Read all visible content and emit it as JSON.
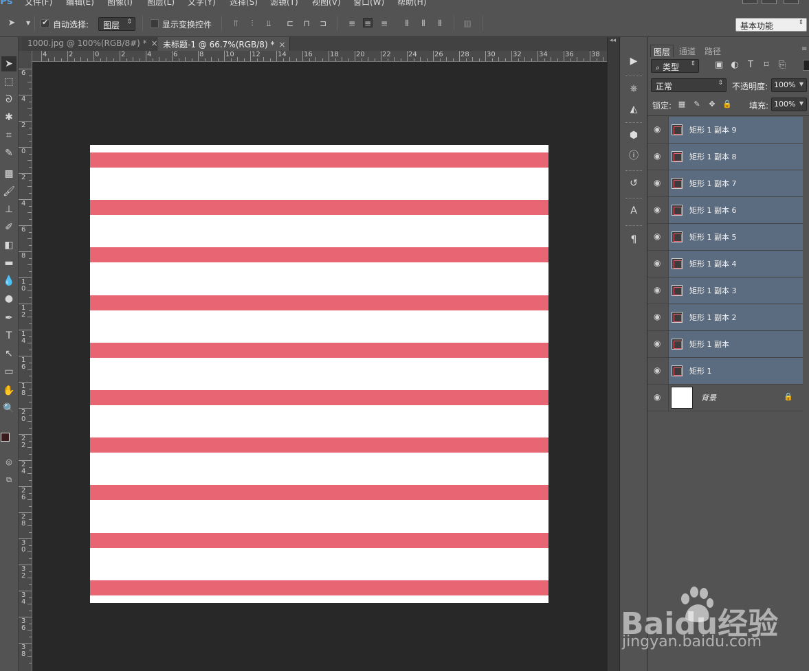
{
  "app": {
    "logo_label": "Ps"
  },
  "menu": [
    "文件(F)",
    "编辑(E)",
    "图像(I)",
    "图层(L)",
    "文字(Y)",
    "选择(S)",
    "滤镜(T)",
    "视图(V)",
    "窗口(W)",
    "帮助(H)"
  ],
  "options_bar": {
    "auto_select_label": "自动选择:",
    "auto_select_checked": true,
    "auto_select_target": "图层",
    "show_transform_label": "显示变换控件",
    "show_transform_checked": false,
    "workspace_preset": "基本功能"
  },
  "doc_tabs": [
    {
      "title": "1000.jpg @ 100%(RGB/8#) *",
      "active": false
    },
    {
      "title": "未标题-1 @ 66.7%(RGB/8) *",
      "active": true
    }
  ],
  "close_glyph": "×",
  "ruler_top_labels": [
    "4",
    "2",
    "0",
    "2",
    "4",
    "6",
    "8",
    "10",
    "12",
    "14",
    "16",
    "18",
    "20",
    "22",
    "24",
    "26",
    "28",
    "30",
    "32",
    "34",
    "36",
    "38"
  ],
  "ruler_left_labels": [
    "6",
    "4",
    "2",
    "0",
    "2",
    "4",
    "6",
    "8",
    "10",
    "12",
    "14",
    "16",
    "18",
    "20",
    "22",
    "24",
    "26",
    "28",
    "30",
    "32",
    "34",
    "36",
    "38"
  ],
  "canvas": {
    "background": "#ffffff",
    "stripe_color": "#e86674",
    "stripe_count": 10
  },
  "layers_panel": {
    "tabs": [
      "图层",
      "通道",
      "路径"
    ],
    "filter_label": "类型",
    "blend_mode": "正常",
    "opacity_label": "不透明度:",
    "opacity_value": "100%",
    "lock_label": "锁定:",
    "fill_label": "填充:",
    "fill_value": "100%",
    "layers": [
      {
        "name": "矩形 1 副本 9",
        "selected": true
      },
      {
        "name": "矩形 1 副本 8",
        "selected": true
      },
      {
        "name": "矩形 1 副本 7",
        "selected": true
      },
      {
        "name": "矩形 1 副本 6",
        "selected": true
      },
      {
        "name": "矩形 1 副本 5",
        "selected": true
      },
      {
        "name": "矩形 1 副本 4",
        "selected": true
      },
      {
        "name": "矩形 1 副本 3",
        "selected": true
      },
      {
        "name": "矩形 1 副本 2",
        "selected": true
      },
      {
        "name": "矩形 1 副本",
        "selected": true
      },
      {
        "name": "矩形 1",
        "selected": true
      }
    ],
    "background_layer": {
      "name": "背景",
      "locked": true
    }
  },
  "watermark": {
    "brand": "Baidu经验",
    "url": "jingyan.baidu.com"
  },
  "colors": {
    "ui_panel": "#535353",
    "ui_dark": "#282828",
    "selected_layer": "#5b6b80",
    "foreground_swatch": "#3a1c1c",
    "background_swatch": "#ffffff"
  }
}
